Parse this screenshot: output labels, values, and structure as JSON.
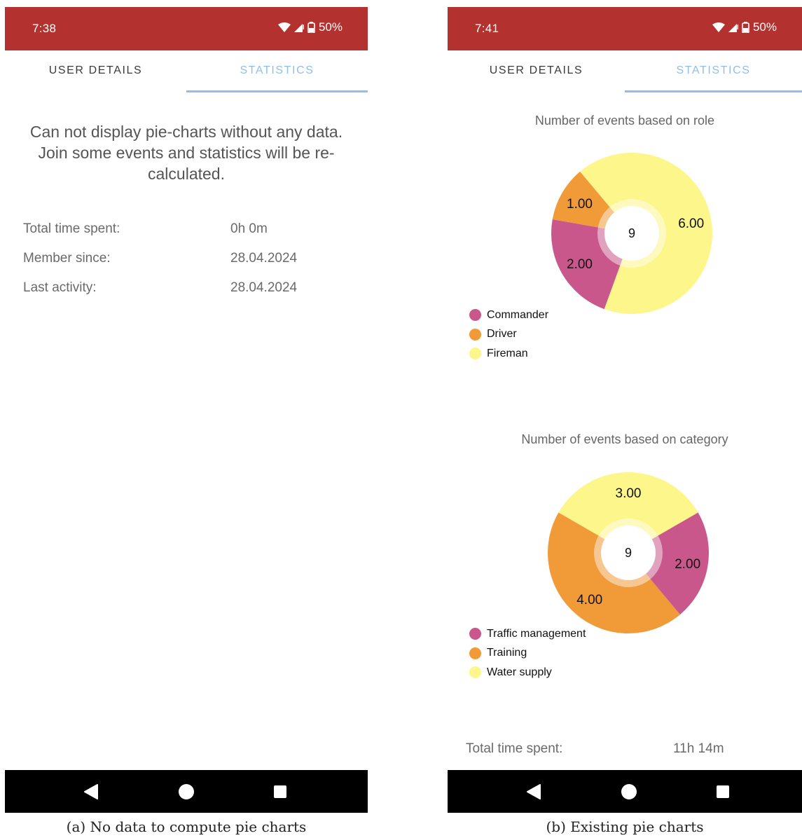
{
  "colors": {
    "status_bar": "#b3322f",
    "tab_active": "#8fbfe8",
    "commander": "#c9578c",
    "driver": "#f09a38",
    "fireman": "#fdf68a"
  },
  "screen_a": {
    "status": {
      "time": "7:38",
      "battery": "50%"
    },
    "tabs": {
      "user_details": "USER DETAILS",
      "statistics": "STATISTICS"
    },
    "empty_message": "Can not display pie-charts without any data. Join some events and statistics will be re-calculated.",
    "info": [
      {
        "label": "Total time spent:",
        "value": "0h 0m"
      },
      {
        "label": "Member since:",
        "value": "28.04.2024"
      },
      {
        "label": "Last activity:",
        "value": "28.04.2024"
      }
    ],
    "caption": "(a) No data to compute pie charts"
  },
  "screen_b": {
    "status": {
      "time": "7:41",
      "battery": "50%"
    },
    "tabs": {
      "user_details": "USER DETAILS",
      "statistics": "STATISTICS"
    },
    "total_label": "Total time spent:",
    "total_value": "11h 14m",
    "caption": "(b) Existing pie charts"
  },
  "chart_data": [
    {
      "type": "pie",
      "title": "Number of events based on role",
      "center_text": "9",
      "categories": [
        "Commander",
        "Driver",
        "Fireman"
      ],
      "values": [
        2,
        1,
        6
      ],
      "value_labels": [
        "2.00",
        "1.00",
        "6.00"
      ],
      "colors": [
        "#c9578c",
        "#f09a38",
        "#fdf68a"
      ],
      "legend_placement": "bottom-left"
    },
    {
      "type": "pie",
      "title": "Number of events based on category",
      "center_text": "9",
      "categories": [
        "Traffic management",
        "Training",
        "Water supply"
      ],
      "values": [
        2,
        4,
        3
      ],
      "value_labels": [
        "2.00",
        "4.00",
        "3.00"
      ],
      "colors": [
        "#c9578c",
        "#f09a38",
        "#fdf68a"
      ],
      "legend_placement": "bottom-left"
    }
  ]
}
